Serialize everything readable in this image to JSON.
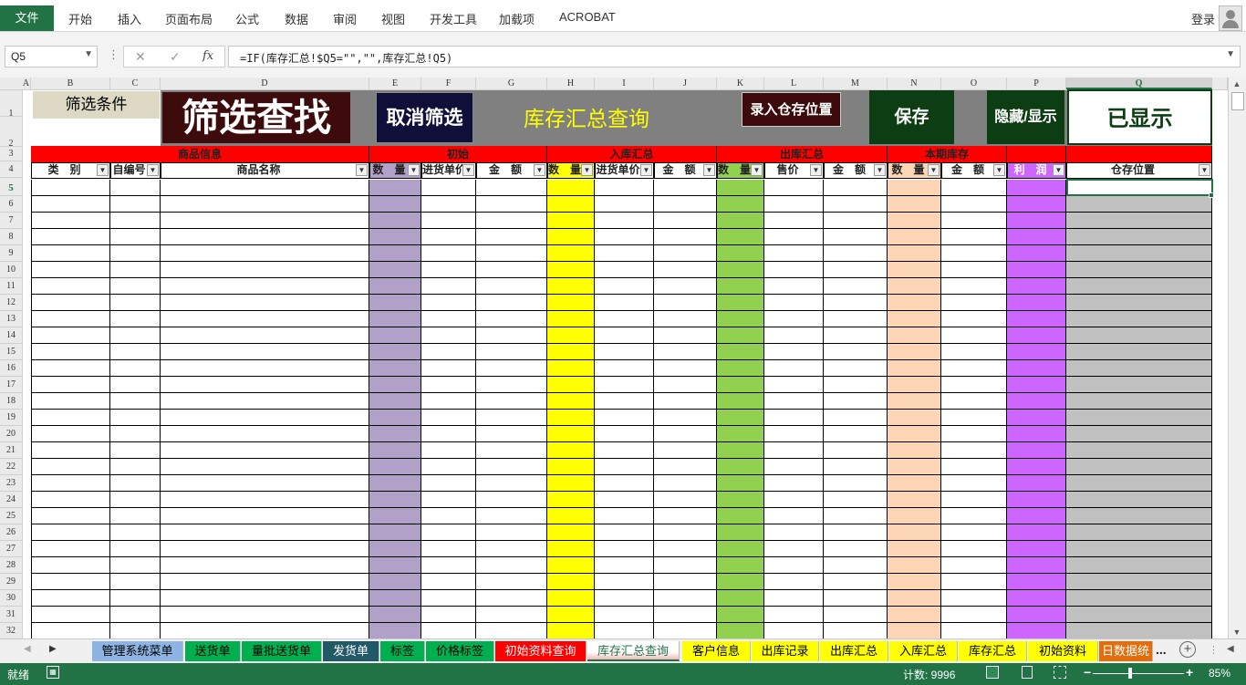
{
  "ribbon": {
    "file_tab": "文件",
    "tabs": [
      "开始",
      "插入",
      "页面布局",
      "公式",
      "数据",
      "审阅",
      "视图",
      "开发工具",
      "加载项",
      "ACROBAT"
    ],
    "login": "登录"
  },
  "formula_bar": {
    "name_box": "Q5",
    "cancel_glyph": "✕",
    "confirm_glyph": "✓",
    "fx_label": "fx",
    "formula": "=IF(库存汇总!$Q5=\"\",\"\",库存汇总!Q5)"
  },
  "columns": [
    "A",
    "B",
    "C",
    "D",
    "E",
    "F",
    "G",
    "H",
    "I",
    "J",
    "K",
    "L",
    "M",
    "N",
    "O",
    "P",
    "Q"
  ],
  "rows": [
    "1",
    "2",
    "3",
    "4",
    "5",
    "6",
    "7",
    "8",
    "9",
    "10",
    "11",
    "12",
    "13",
    "14",
    "15",
    "16",
    "17",
    "18",
    "19",
    "20",
    "21",
    "22",
    "23",
    "24",
    "25",
    "26",
    "27",
    "28",
    "29",
    "30",
    "31",
    "32"
  ],
  "active_cell": {
    "column": "Q",
    "row": "5"
  },
  "buttons": {
    "filter_condition": "筛选条件",
    "filter_search": "筛选查找",
    "cancel_filter": "取消筛选",
    "title": "库存汇总查询",
    "enter_location": "录入仓存位置",
    "save": "保存",
    "hide_show": "隐藏/显示",
    "shown": "已显示"
  },
  "groups": {
    "product_info": "商品信息",
    "initial": "初始",
    "inbound": "入库汇总",
    "outbound": "出库汇总",
    "period_stock": "本期库存"
  },
  "headers": {
    "category": "类　别",
    "auto_code": "自编号",
    "product_name": "商品名称",
    "init_qty": "数　量",
    "init_price": "进货单价",
    "init_amount": "金　额",
    "in_qty": "数　量",
    "in_price": "进货单价",
    "in_amount": "金　额",
    "out_qty": "数　量",
    "out_price": "售价",
    "out_amount": "金　额",
    "stock_qty": "数　量",
    "stock_amount": "金　额",
    "profit": "利　润",
    "location": "仓存位置"
  },
  "colors": {
    "excel_green": "#217346",
    "group_red": "#ff0000",
    "col_e": "#b1a0c7",
    "col_h": "#ffff00",
    "col_k": "#92d050",
    "col_n": "#fcd5b4",
    "col_p": "#cc66ff",
    "col_q": "#c0c0c0"
  },
  "sheet_tabs": [
    {
      "label": "管理系统菜单",
      "bg": "#8db4e2",
      "fg": "#000000"
    },
    {
      "label": "送货单",
      "bg": "#00b050",
      "fg": "#000000"
    },
    {
      "label": "量批送货单",
      "bg": "#00b050",
      "fg": "#000000"
    },
    {
      "label": "发货单",
      "bg": "#215967",
      "fg": "#ffffff"
    },
    {
      "label": "标签",
      "bg": "#00b050",
      "fg": "#000000"
    },
    {
      "label": "价格标签",
      "bg": "#00b050",
      "fg": "#000000"
    },
    {
      "label": "初始资料查询",
      "bg": "#ff0000",
      "fg": "#ffffff"
    },
    {
      "label": "库存汇总查询",
      "bg": "#ffffff",
      "fg": "#217346"
    },
    {
      "label": "客户信息",
      "bg": "#ffff00",
      "fg": "#000000"
    },
    {
      "label": "出库记录",
      "bg": "#ffff00",
      "fg": "#000000"
    },
    {
      "label": "出库汇总",
      "bg": "#ffff00",
      "fg": "#000000"
    },
    {
      "label": "入库汇总",
      "bg": "#ffff00",
      "fg": "#000000"
    },
    {
      "label": "库存汇总",
      "bg": "#ffff00",
      "fg": "#000000"
    },
    {
      "label": "初始资料",
      "bg": "#ffff00",
      "fg": "#000000"
    },
    {
      "label": "日数据统",
      "bg": "#e46c0a",
      "fg": "#ffffff"
    }
  ],
  "tab_more": "...",
  "status": {
    "ready": "就绪",
    "count": "计数: 9996",
    "zoom": "85%"
  }
}
